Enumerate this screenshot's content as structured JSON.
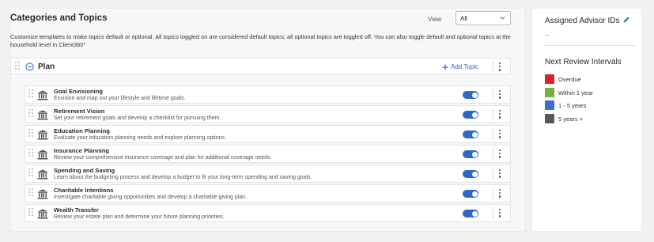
{
  "main": {
    "title": "Categories and Topics",
    "view_label": "View",
    "view_value": "All",
    "description": "Customize templates to make topics default or optional. All topics toggled on are considered default topics; all optional topics are toggled off. You can also toggle default and optional topics at the household level in Client360°",
    "category": {
      "title": "Plan",
      "add_topic_label": "Add Topic",
      "topics": [
        {
          "title": "Goal Envisioning",
          "description": "Envision and map out your lifestyle and lifetime goals.",
          "enabled": true
        },
        {
          "title": "Retirement Vision",
          "description": "Set your retirement goals and develop a checklist for pursuing them.",
          "enabled": true
        },
        {
          "title": "Education Planning",
          "description": "Evaluate your education planning needs and explore planning options.",
          "enabled": true
        },
        {
          "title": "Insurance Planning",
          "description": "Review your comprehensive insurance coverage and plan for additional coverage needs.",
          "enabled": true
        },
        {
          "title": "Spending and Saving",
          "description": "Learn about the budgeting process and develop a budget to fit your long-term spending and saving goals.",
          "enabled": true
        },
        {
          "title": "Charitable Intentions",
          "description": "Investigate charitable giving opportunities and develop a charitable giving plan.",
          "enabled": true
        },
        {
          "title": "Wealth Transfer",
          "description": "Review your estate plan and determine your future planning priorities.",
          "enabled": true
        }
      ]
    }
  },
  "side": {
    "advisor_title": "Assigned Advisor IDs",
    "advisor_value": "--",
    "review_title": "Next Review Intervals",
    "legend": [
      {
        "label": "Overdue",
        "color": "#d2262a"
      },
      {
        "label": "Within 1 year",
        "color": "#76b043"
      },
      {
        "label": "1 - 5 years",
        "color": "#3a6fd1"
      },
      {
        "label": "5 years +",
        "color": "#595959"
      }
    ]
  },
  "colors": {
    "accent": "#2f67c8"
  }
}
